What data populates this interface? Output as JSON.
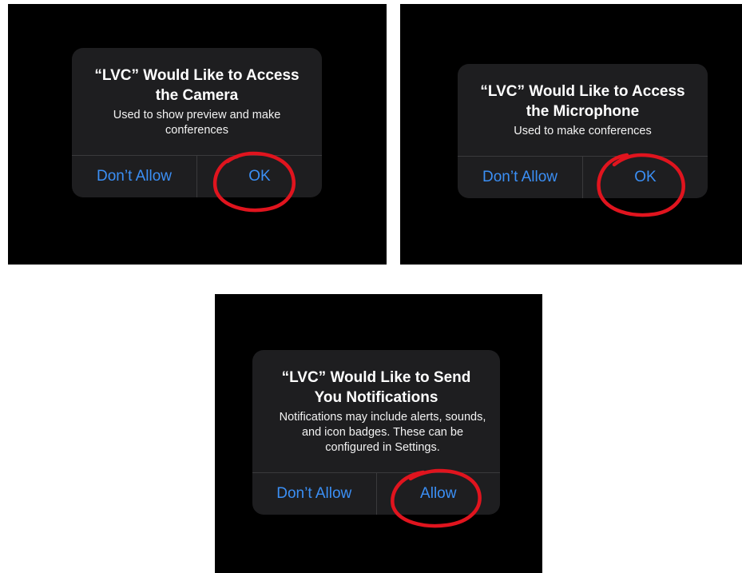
{
  "panels": [
    {
      "title": "“LVC” Would Like to Access the Camera",
      "message": "Used to show preview and make conferences",
      "buttons": {
        "left": "Don’t Allow",
        "right": "OK"
      }
    },
    {
      "title": "“LVC” Would Like to Access the Microphone",
      "message": "Used to make conferences",
      "buttons": {
        "left": "Don’t Allow",
        "right": "OK"
      }
    },
    {
      "title": "“LVC” Would Like to Send You Notifications",
      "message": "Notifications may include alerts, sounds, and icon badges. These can be configured in Settings.",
      "buttons": {
        "left": "Don’t Allow",
        "right": "Allow"
      }
    }
  ],
  "colors": {
    "background": "#000000",
    "alert_bg": "#1e1e20",
    "button_text": "#3b8ff5",
    "annotation_circle": "#e0141e"
  },
  "annotations": [
    {
      "type": "circle",
      "target": "panels.0.buttons.right"
    },
    {
      "type": "circle",
      "target": "panels.1.buttons.right"
    },
    {
      "type": "circle",
      "target": "panels.2.buttons.right"
    }
  ]
}
